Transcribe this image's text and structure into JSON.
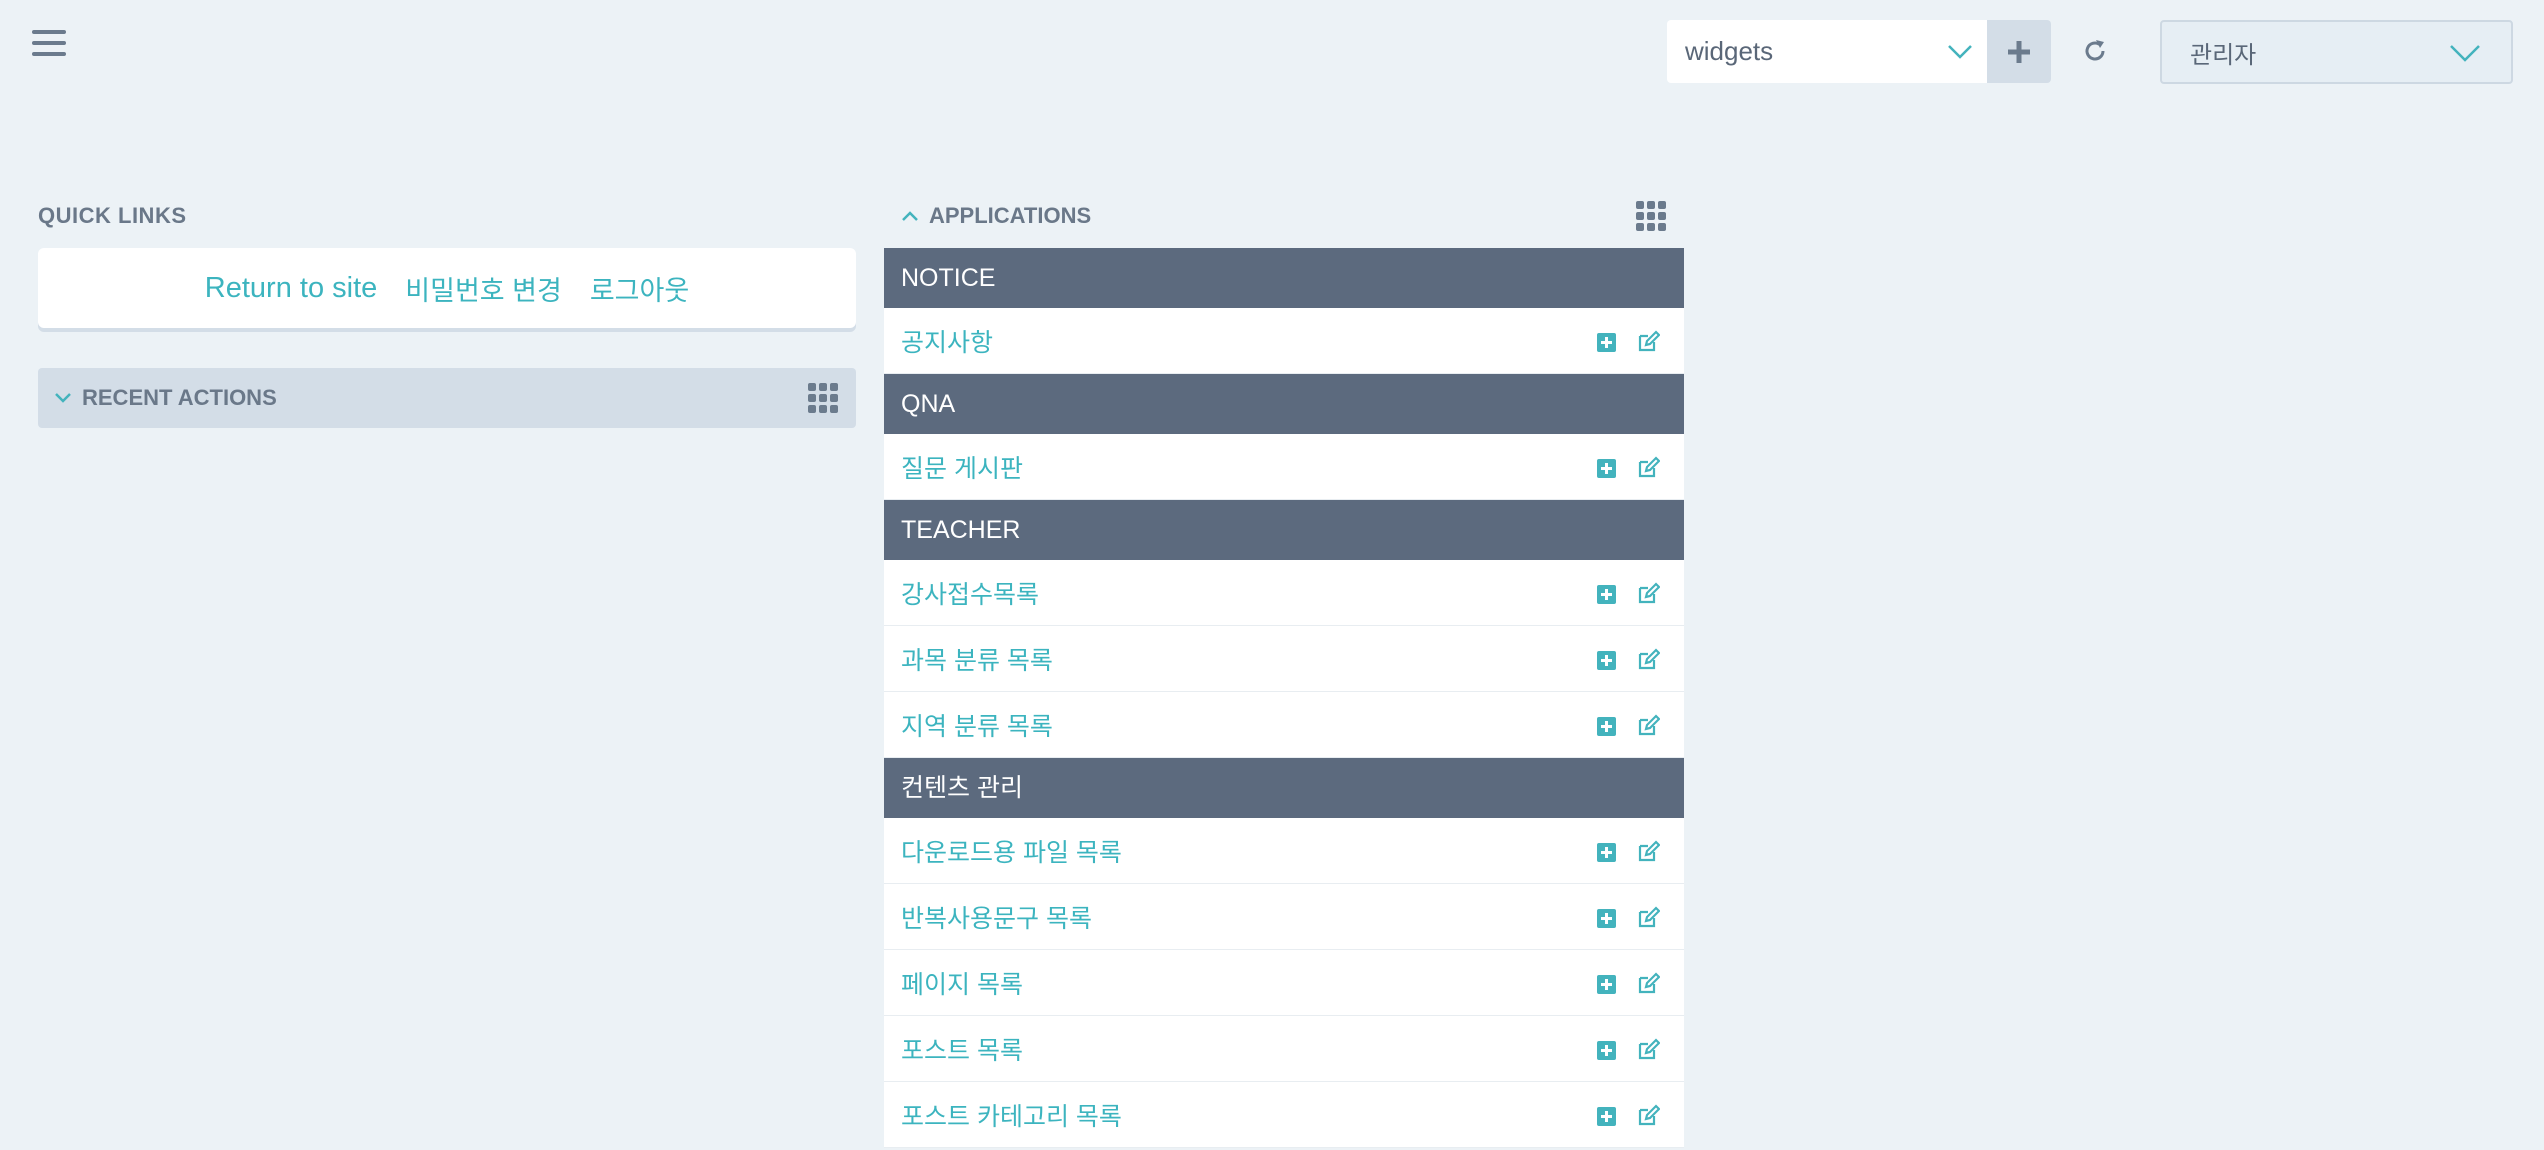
{
  "toolbar": {
    "menu_icon": "hamburger-icon",
    "widget_select_value": "widgets",
    "add_icon": "plus-icon",
    "refresh_icon": "refresh-icon",
    "user_select_value": "관리자"
  },
  "quick_links": {
    "title": "QUICK LINKS",
    "links": [
      "Return to site",
      "비밀번호 변경",
      "로그아웃"
    ]
  },
  "recent_actions": {
    "title": "RECENT ACTIONS"
  },
  "applications": {
    "title": "APPLICATIONS",
    "groups": [
      {
        "name": "NOTICE",
        "models": [
          "공지사항"
        ]
      },
      {
        "name": "QNA",
        "models": [
          "질문 게시판"
        ]
      },
      {
        "name": "TEACHER",
        "models": [
          "강사접수목록",
          "과목 분류 목록",
          "지역 분류 목록"
        ]
      },
      {
        "name": "컨텐츠 관리",
        "models": [
          "다운로드용 파일 목록",
          "반복사용문구 목록",
          "페이지 목록",
          "포스트 목록",
          "포스트 카테고리 목록"
        ]
      }
    ]
  },
  "colors": {
    "background": "#ecf2f6",
    "accent": "#3cb4bf",
    "group_header": "#5c6a7e",
    "muted_bar": "#d3dde7"
  }
}
